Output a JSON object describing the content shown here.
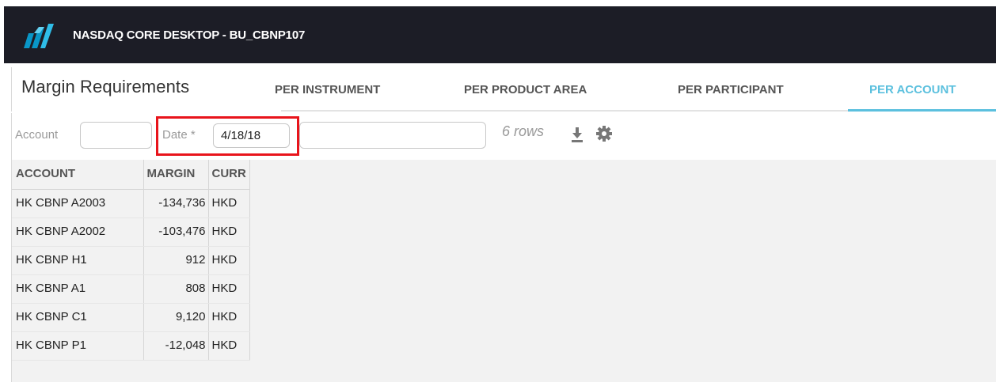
{
  "app": {
    "title": "NASDAQ CORE DESKTOP - BU_CBNP107",
    "logo_icon": "nasdaq-logo-icon",
    "brand_color": "#1c1d26",
    "accent_color": "#5bc0de"
  },
  "header": {
    "page_title": "Margin Requirements",
    "tabs": [
      {
        "label": "PER INSTRUMENT",
        "active": false
      },
      {
        "label": "PER PRODUCT AREA",
        "active": false
      },
      {
        "label": "PER PARTICIPANT",
        "active": false
      },
      {
        "label": "PER ACCOUNT",
        "active": true
      }
    ]
  },
  "filters": {
    "account_label": "Account",
    "account_value": "",
    "date_label": "Date *",
    "date_value": "4/18/18",
    "extra_value": "",
    "row_count": "6 rows",
    "highlight_color": "#e8141b",
    "icons": [
      "download-icon",
      "gear-icon"
    ]
  },
  "table": {
    "columns": [
      "ACCOUNT",
      "MARGIN",
      "CURR"
    ],
    "rows": [
      {
        "account": "HK CBNP A2003",
        "margin": "-134,736",
        "curr": "HKD"
      },
      {
        "account": "HK CBNP A2002",
        "margin": "-103,476",
        "curr": "HKD"
      },
      {
        "account": "HK CBNP H1",
        "margin": "912",
        "curr": "HKD"
      },
      {
        "account": "HK CBNP A1",
        "margin": "808",
        "curr": "HKD"
      },
      {
        "account": "HK CBNP C1",
        "margin": "9,120",
        "curr": "HKD"
      },
      {
        "account": "HK CBNP P1",
        "margin": "-12,048",
        "curr": "HKD"
      }
    ]
  }
}
